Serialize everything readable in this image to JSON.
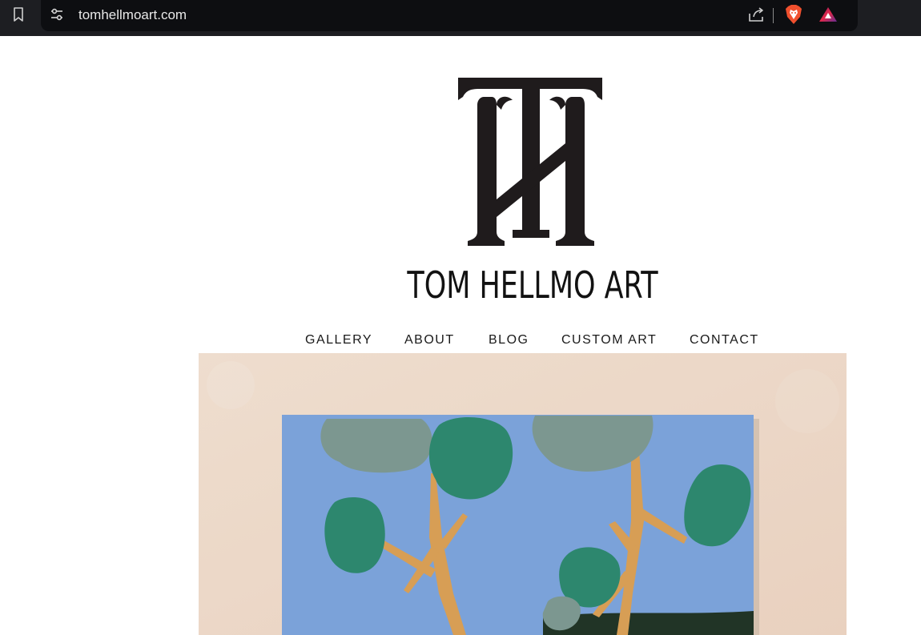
{
  "browser": {
    "url": "tomhellmoart.com",
    "icons": [
      "bookmark-icon",
      "site-settings-icon",
      "share-icon",
      "brave-shield-icon",
      "brave-rewards-icon"
    ]
  },
  "site": {
    "logo_icon": "th-monogram-logo",
    "title": "TOM HELLMO ART"
  },
  "nav": {
    "items": [
      {
        "label": "GALLERY"
      },
      {
        "label": "ABOUT"
      },
      {
        "label": "BLOG"
      },
      {
        "label": "CUSTOM ART"
      },
      {
        "label": "CONTACT"
      }
    ]
  },
  "hero": {
    "image": "painting-of-trees-on-blue-canvas"
  },
  "colors": {
    "browser_bg": "#1d1e22",
    "address_bg": "#0d0e11",
    "text_dark": "#121212",
    "canvas_blue": "#7ea6de",
    "tree_green": "#2f8b72",
    "trunk_orange": "#dba054",
    "wall_beige": "#f1dccb"
  }
}
